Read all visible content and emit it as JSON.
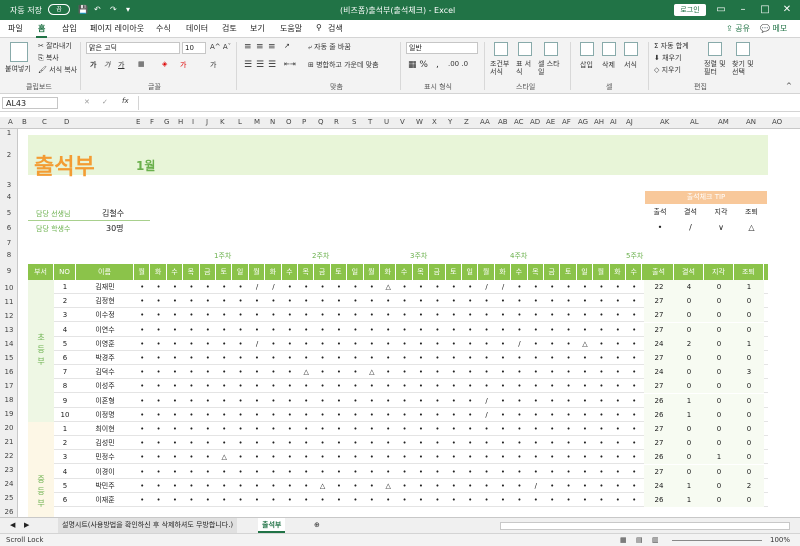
{
  "window": {
    "autosave": "자동 저장",
    "autosave_state": "끔",
    "doc_title": "(비즈폼)출석부(출석체크) - Excel",
    "login": "로그인"
  },
  "tabs": [
    "파일",
    "홈",
    "삽입",
    "페이지 레이아웃",
    "수식",
    "데이터",
    "검토",
    "보기",
    "도움말",
    "검색"
  ],
  "share": "공유",
  "memo": "메모",
  "ribbon": {
    "paste": "붙여넣기",
    "cut": "잘라내기",
    "copy": "복사",
    "format_paint": "서식 복사",
    "clipboard": "클립보드",
    "font_name": "맑은 고딕",
    "font_size": "10",
    "font_group": "글꼴",
    "wrap": "자동 줄 바꿈",
    "merge": "병합하고 가운데 맞춤",
    "align_group": "맞춤",
    "num_format": "일반",
    "num_group": "표시 형식",
    "cond": "조건부 서식",
    "table": "표 서식",
    "cellstyle": "셀 스타일",
    "style_group": "스타일",
    "insert": "삽입",
    "delete": "삭제",
    "format": "서식",
    "cell_group": "셀",
    "autosum": "자동 합계",
    "fill": "채우기",
    "clear": "지우기",
    "sortfilter": "정렬 및 필터",
    "findselect": "찾기 및 선택",
    "edit_group": "편집"
  },
  "namebox": "AL43",
  "fx": "fx",
  "columns": [
    "A",
    "B",
    "C",
    "D",
    "E",
    "F",
    "G",
    "H",
    "I",
    "J",
    "K",
    "L",
    "M",
    "N",
    "O",
    "P",
    "Q",
    "R",
    "S",
    "T",
    "U",
    "V",
    "W",
    "X",
    "Y",
    "Z",
    "AA",
    "AB",
    "AC",
    "AD",
    "AE",
    "AF",
    "AG",
    "AH",
    "AI",
    "AJ",
    "AK",
    "AL",
    "AM",
    "AN",
    "AO"
  ],
  "rows": [
    "1",
    "2",
    "3",
    "4",
    "5",
    "6",
    "7",
    "8",
    "9",
    "10",
    "11",
    "12",
    "13",
    "14",
    "15",
    "16",
    "17",
    "18",
    "19",
    "20",
    "21",
    "22",
    "23",
    "24",
    "25",
    "26"
  ],
  "sheet": {
    "title": "출석부",
    "month": "1월",
    "teacher_label": "담당 선생님",
    "teacher": "김철수",
    "students_label": "담당 학생수",
    "students": "30명",
    "tip_title": "출석체크 TIP",
    "tip_labels": [
      "출석",
      "결석",
      "지각",
      "조퇴"
    ],
    "tip_symbols": [
      "•",
      "/",
      "∨",
      "△"
    ],
    "weeks": [
      "1주차",
      "2주차",
      "3주차",
      "4주차",
      "5주차"
    ],
    "hdr_group": "부서",
    "hdr_no": "NO",
    "hdr_name": "이름",
    "days": [
      "월",
      "화",
      "수",
      "목",
      "금",
      "토",
      "일",
      "월",
      "화",
      "수",
      "목",
      "금",
      "토",
      "일",
      "월",
      "화",
      "수",
      "목",
      "금",
      "토",
      "일",
      "월",
      "화",
      "수",
      "목",
      "금",
      "토",
      "일",
      "월",
      "화",
      "수"
    ],
    "sum_headers": [
      "출석",
      "결석",
      "지각",
      "조퇴"
    ],
    "groups": [
      "초등부",
      "중등부"
    ],
    "students_rows": [
      {
        "no": "1",
        "name": "김재민",
        "marks": "•••••••//••••••△•••••//••••••••",
        "sum": [
          "22",
          "4",
          "0",
          "1"
        ]
      },
      {
        "no": "2",
        "name": "김정현",
        "marks": "••••••••••••••••••••••••••••••• ",
        "sum": [
          "27",
          "0",
          "0",
          "0"
        ]
      },
      {
        "no": "3",
        "name": "이수정",
        "marks": "•••••••••••••••••••••••••••••••",
        "sum": [
          "27",
          "0",
          "0",
          "0"
        ]
      },
      {
        "no": "4",
        "name": "이연수",
        "marks": "•••••••••••••••••••••••••••••••",
        "sum": [
          "27",
          "0",
          "0",
          "0"
        ]
      },
      {
        "no": "5",
        "name": "이영훈",
        "marks": "•••••••/•••••••••••••••/•••△•••",
        "sum": [
          "24",
          "2",
          "0",
          "1"
        ]
      },
      {
        "no": "6",
        "name": "박경주",
        "marks": "•••••••••••••••••••••••••••••••",
        "sum": [
          "27",
          "0",
          "0",
          "0"
        ]
      },
      {
        "no": "7",
        "name": "김덕수",
        "marks": "••••••••••△•••△••••••••••••••••",
        "sum": [
          "24",
          "0",
          "0",
          "3"
        ]
      },
      {
        "no": "8",
        "name": "이성주",
        "marks": "•••••••••••••••••••••••••••••••",
        "sum": [
          "27",
          "0",
          "0",
          "0"
        ]
      },
      {
        "no": "9",
        "name": "이혼형",
        "marks": "•••••••••••••••••••••/•••••••••",
        "sum": [
          "26",
          "1",
          "0",
          "0"
        ]
      },
      {
        "no": "10",
        "name": "이정명",
        "marks": "•••••••••••••••••••••/•••••••••",
        "sum": [
          "26",
          "1",
          "0",
          "0"
        ]
      },
      {
        "no": "1",
        "name": "최이현",
        "marks": "•••••••••••••••••••••••••••••••",
        "sum": [
          "27",
          "0",
          "0",
          "0"
        ]
      },
      {
        "no": "2",
        "name": "김성민",
        "marks": "••••••••••••••••••••••••••••••• ",
        "sum": [
          "27",
          "0",
          "0",
          "0"
        ]
      },
      {
        "no": "3",
        "name": "민정수",
        "marks": "•••••△•••••••••••••••••••••••••",
        "sum": [
          "26",
          "0",
          "1",
          "0"
        ]
      },
      {
        "no": "4",
        "name": "이경이",
        "marks": "•••••••••••••••••••••••••••••••",
        "sum": [
          "27",
          "0",
          "0",
          "0"
        ]
      },
      {
        "no": "5",
        "name": "박민주",
        "marks": "•••••••••••△•••△••••••••/•••••••",
        "sum": [
          "24",
          "1",
          "0",
          "2"
        ]
      },
      {
        "no": "6",
        "name": "이재훈",
        "marks": "•••••••••••••••••••••••••••••••",
        "sum": [
          "26",
          "1",
          "0",
          "0"
        ]
      }
    ]
  },
  "sheet_tabs": [
    "설명시트(사용방법을 확인하신 후 삭제하셔도 무방합니다.)",
    "출석부"
  ],
  "status": {
    "left": "Scroll Lock",
    "zoom": "100%"
  }
}
